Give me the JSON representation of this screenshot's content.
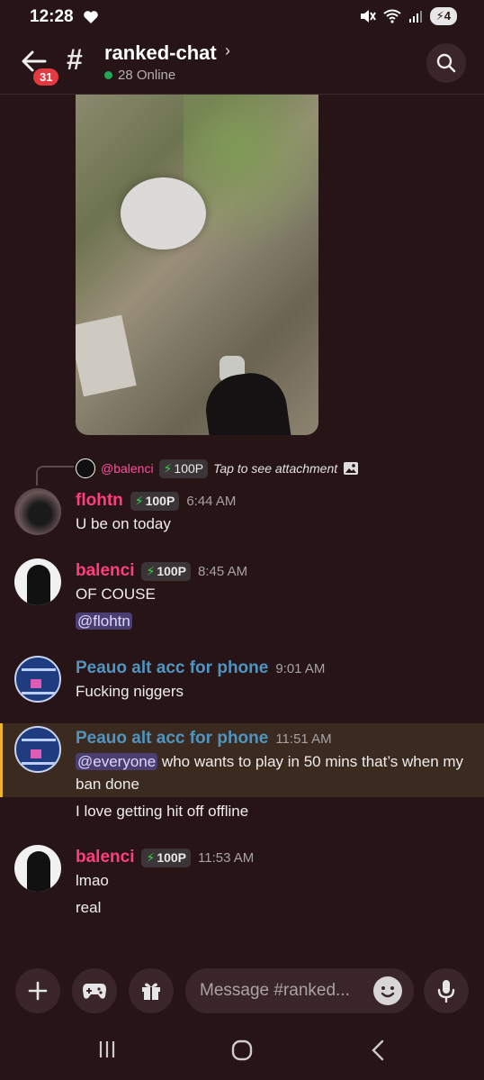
{
  "status": {
    "time": "12:28",
    "battery": "4"
  },
  "header": {
    "unread_count": "31",
    "channel_name": "ranked-chat",
    "online": "28 Online"
  },
  "reply": {
    "mention": "@balenci",
    "tag": "100P",
    "text": "Tap to see attachment"
  },
  "messages": [
    {
      "author": "flohtn",
      "tag": "100P",
      "time": "6:44 AM",
      "lines": [
        "U be on today"
      ]
    },
    {
      "author": "balenci",
      "tag": "100P",
      "time": "8:45 AM",
      "lines": [
        "OF COUSE"
      ],
      "mention": "@flohtn"
    },
    {
      "author": "Peauo alt acc for phone",
      "time": "9:01 AM",
      "lines": [
        "Fucking niggers"
      ]
    },
    {
      "author": "Peauo alt acc for phone",
      "time": "11:51 AM",
      "mention": "@everyone",
      "lines": [
        " who wants to play in 50 mins that’s when my",
        "ban done",
        "I love getting hit off offline"
      ]
    },
    {
      "author": "balenci",
      "tag": "100P",
      "time": "11:53 AM",
      "lines": [
        "lmao",
        "real"
      ]
    }
  ],
  "composer": {
    "placeholder": "Message #ranked..."
  },
  "colors": {
    "background": "#261416",
    "pink_name": "#ff3f7c",
    "blue_name": "#4f95c2",
    "online_dot": "#23a55a",
    "highlight_bar": "#f0b232"
  }
}
